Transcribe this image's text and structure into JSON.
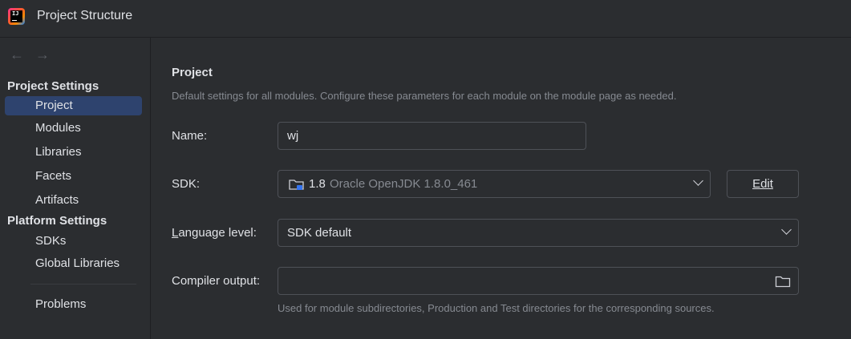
{
  "window": {
    "title": "Project Structure"
  },
  "sidebar": {
    "sections": [
      {
        "header": "Project Settings",
        "items": [
          {
            "label": "Project",
            "selected": true
          },
          {
            "label": "Modules"
          },
          {
            "label": "Libraries"
          },
          {
            "label": "Facets"
          },
          {
            "label": "Artifacts"
          }
        ]
      },
      {
        "header": "Platform Settings",
        "items": [
          {
            "label": "SDKs"
          },
          {
            "label": "Global Libraries"
          }
        ]
      }
    ],
    "problems": "Problems"
  },
  "main": {
    "title": "Project",
    "description": "Default settings for all modules. Configure these parameters for each module on the module page as needed.",
    "name": {
      "label": "Name:",
      "value": "wj"
    },
    "sdk": {
      "label": "SDK:",
      "version": "1.8",
      "detail": "Oracle OpenJDK 1.8.0_461",
      "edit_label": "Edit"
    },
    "language_level": {
      "label_mnemonic": "L",
      "label_rest": "anguage level:",
      "value": "SDK default"
    },
    "compiler_output": {
      "label": "Compiler output:",
      "value": "",
      "hint": "Used for module subdirectories, Production and Test directories for the corresponding sources."
    }
  },
  "colors": {
    "background": "#2b2d30",
    "selection": "#2e436e",
    "border": "#4e5157",
    "muted_text": "#868a91"
  }
}
